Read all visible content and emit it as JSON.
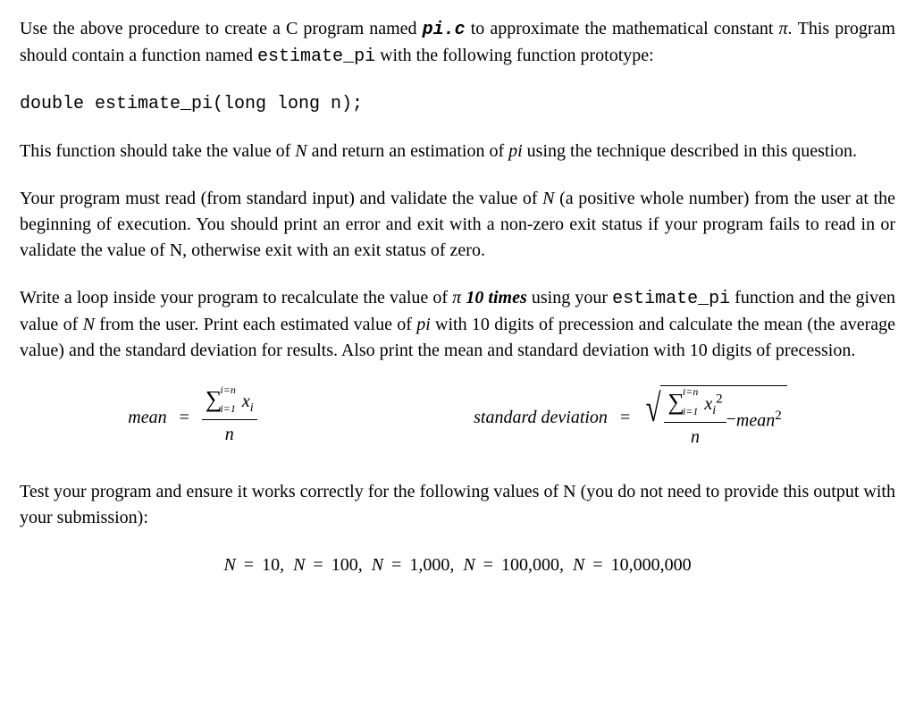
{
  "para1": {
    "t1": "Use the above procedure to create a C program named ",
    "file": "pi.c",
    "t2": " to approximate the mathematical constant ",
    "pi": "π",
    "t3": ". This program should contain a function named ",
    "func": "estimate_pi",
    "t4": " with the following function prototype:"
  },
  "proto": "double estimate_pi(long long n);",
  "para2": {
    "t1": "This function should take the value of ",
    "N": "N",
    "t2": " and return an estimation of ",
    "pi": "pi",
    "t3": " using the technique described in this question."
  },
  "para3": {
    "t1": "Your program must read (from standard input) and validate the value of ",
    "N": "N",
    "t2": " (a positive whole number) from the user at the beginning of execution. You should print an error and exit with a non-zero exit status if your program fails to read in or validate the value of N, otherwise exit with an exit status of zero."
  },
  "para4": {
    "t1": "Write a loop inside your program to recalculate the value of ",
    "pi": "π",
    "times": "10 times",
    "t2": " using your ",
    "func": "estimate_pi",
    "t3": " function and the given value of ",
    "N": "N",
    "t4": " from the user. Print each estimated value of ",
    "pi2": "pi",
    "t5": " with 10 digits of precession and calculate the mean (the average value) and the standard deviation for results. Also print the mean and standard deviation with 10 digits of precession."
  },
  "formulas": {
    "mean": "mean",
    "std": "standard deviation",
    "sum_top": "i=n",
    "sum_bot": "i=1",
    "xi": "x",
    "isub": "i",
    "n": "n",
    "sq": "2",
    "minus": " − ",
    "mean2": "mean"
  },
  "para5": "Test your program and ensure it works correctly for the following values of N (you do not need to provide this output with your submission):",
  "testvals": {
    "items": [
      {
        "n": "N",
        "v": "10"
      },
      {
        "n": "N",
        "v": "100"
      },
      {
        "n": "N",
        "v": "1,000"
      },
      {
        "n": "N",
        "v": "100,000"
      },
      {
        "n": "N",
        "v": "10,000,000"
      }
    ]
  }
}
